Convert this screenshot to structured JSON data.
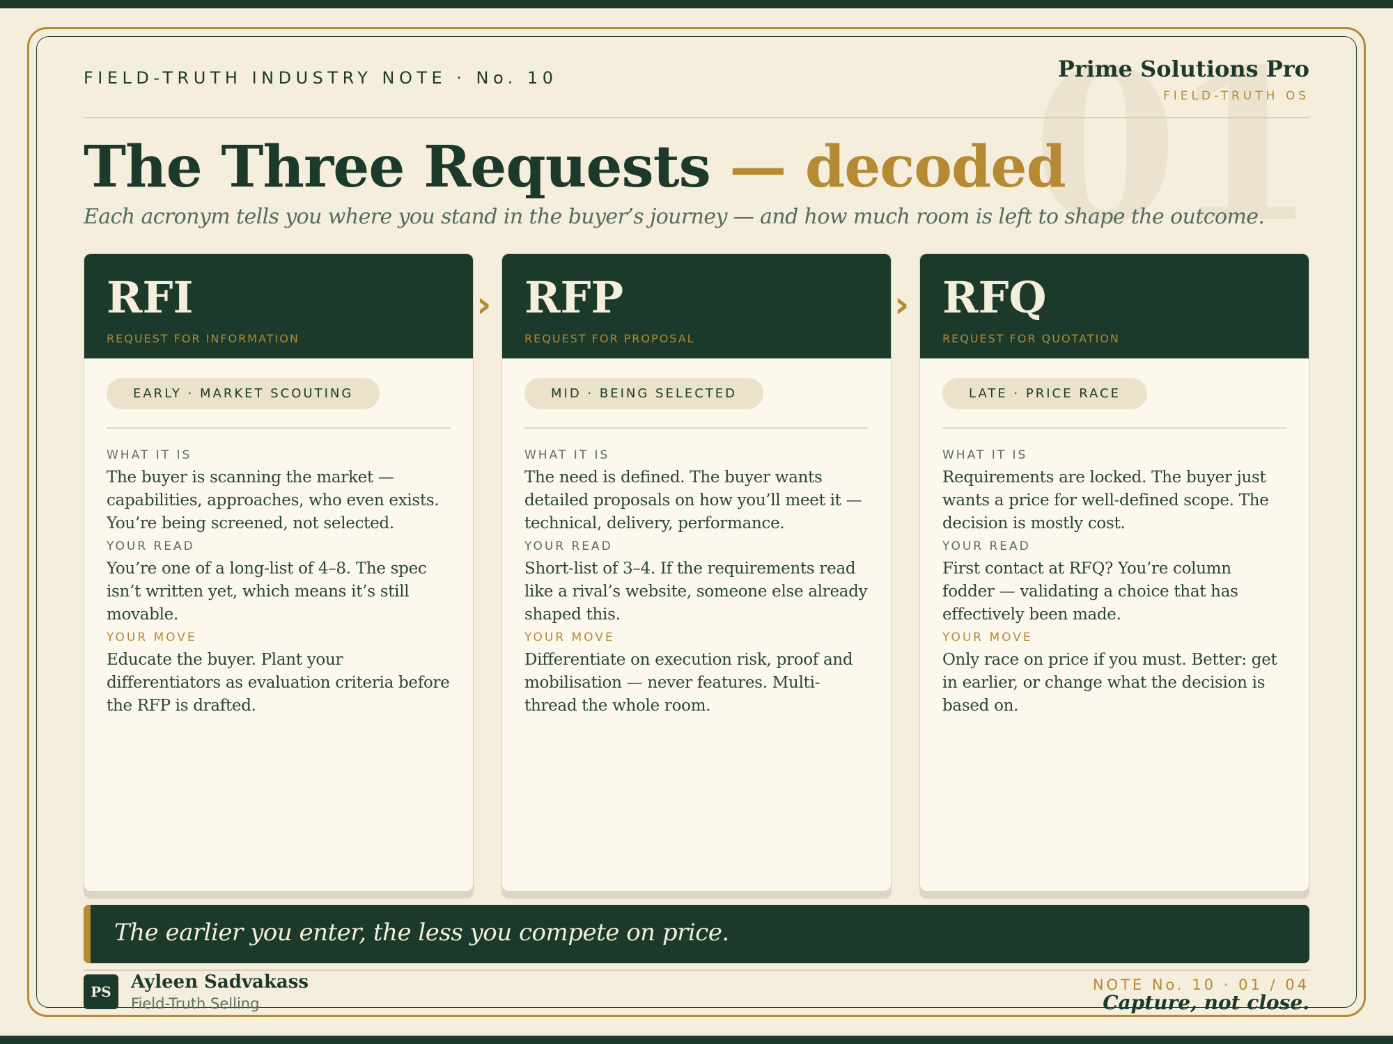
{
  "header": {
    "kicker": "FIELD-TRUTH INDUSTRY NOTE · No. 10",
    "brand_name": "Prime Solutions Pro",
    "brand_sub": "FIELD-TRUTH OS",
    "watermark": "01"
  },
  "title": {
    "main": "The Three Requests",
    "accent": "— decoded",
    "subtitle": "Each acronym tells you where you stand in the buyer’s journey — and how much room is left to shape the outcome."
  },
  "labels": {
    "what": "WHAT IT IS",
    "read": "YOUR READ",
    "move": "YOUR MOVE"
  },
  "cards": [
    {
      "code": "RFI",
      "full": "REQUEST FOR INFORMATION",
      "stage": "EARLY · MARKET SCOUTING",
      "what": "The buyer is scanning the market — capabilities, approaches, who even exists. You’re being screened, not selected.",
      "read": "You’re one of a long-list of 4–8. The spec isn’t written yet, which means it’s still movable.",
      "move": "Educate the buyer. Plant your differentiators as evaluation criteria before the RFP is drafted."
    },
    {
      "code": "RFP",
      "full": "REQUEST FOR PROPOSAL",
      "stage": "MID · BEING SELECTED",
      "what": "The need is defined. The buyer wants detailed proposals on how you’ll meet it — technical, delivery, performance.",
      "read": "Short-list of 3–4. If the requirements read like a rival’s website, someone else already shaped this.",
      "move": "Differentiate on execution risk, proof and mobilisation — never features. Multi-thread the whole room."
    },
    {
      "code": "RFQ",
      "full": "REQUEST FOR QUOTATION",
      "stage": "LATE · PRICE RACE",
      "what": "Requirements are locked. The buyer just wants a price for well-defined scope. The decision is mostly cost.",
      "read": "First contact at RFQ? You’re column fodder — validating a choice that has effectively been made.",
      "move": "Only race on price if you must. Better: get in earlier, or change what the decision is based on."
    }
  ],
  "banner": {
    "text": "The earlier you enter, the less you compete on price."
  },
  "footer": {
    "avatar_initials": "PS",
    "author_name": "Ayleen Sadvakass",
    "author_org": "Field-Truth Selling",
    "note_number": "NOTE No. 10 · 01 / 04",
    "tagline": "Capture, not close."
  },
  "icons": {
    "arrow": "chevron-right-icon"
  },
  "colors": {
    "forest": "#1c3a2b",
    "gold": "#b58a33",
    "cream": "#f5eedd"
  }
}
